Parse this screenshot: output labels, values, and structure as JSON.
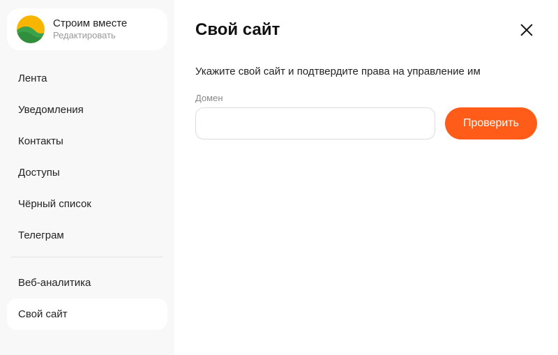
{
  "profile": {
    "name": "Строим вместе",
    "edit_label": "Редактировать"
  },
  "sidebar": {
    "items": [
      {
        "label": "Лента"
      },
      {
        "label": "Уведомления"
      },
      {
        "label": "Контакты"
      },
      {
        "label": "Доступы"
      },
      {
        "label": "Чёрный список"
      },
      {
        "label": "Телеграм"
      }
    ],
    "items2": [
      {
        "label": "Веб-аналитика"
      },
      {
        "label": "Свой сайт"
      }
    ],
    "active_label": "Свой сайт"
  },
  "panel": {
    "title": "Свой сайт",
    "instruction": "Укажите свой сайт и подтвердите права на управление им",
    "domain_label": "Домен",
    "domain_value": "",
    "verify_button": "Проверить"
  },
  "colors": {
    "accent": "#ff5c1a"
  }
}
